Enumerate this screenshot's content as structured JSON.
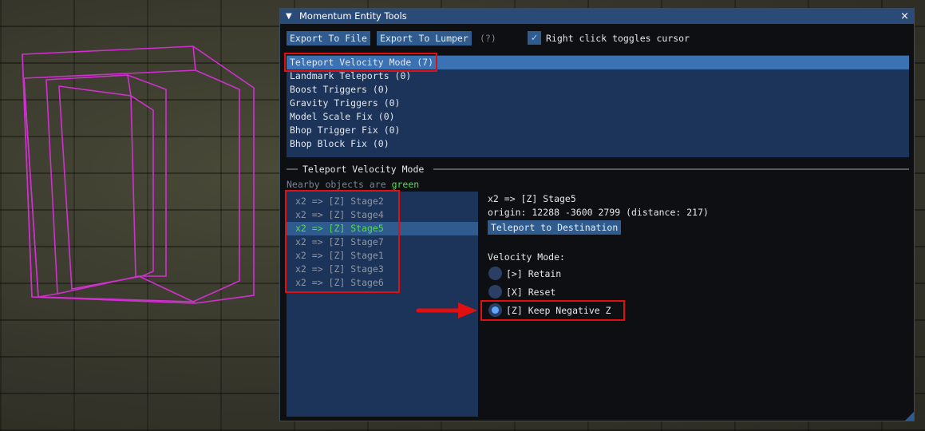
{
  "window": {
    "title": "Momentum Entity Tools",
    "close_glyph": "×",
    "collapse_glyph": "▼"
  },
  "toolbar": {
    "export_file": "Export To File",
    "export_lumper": "Export To Lumper",
    "help": "(?)",
    "cursor_toggle_label": "Right click toggles cursor",
    "cursor_toggle_checked": true
  },
  "categories": [
    {
      "label": "Teleport Velocity Mode (7)",
      "selected": true
    },
    {
      "label": "Landmark Teleports (0)",
      "selected": false
    },
    {
      "label": "Boost Triggers (0)",
      "selected": false
    },
    {
      "label": "Gravity Triggers (0)",
      "selected": false
    },
    {
      "label": "Model Scale Fix (0)",
      "selected": false
    },
    {
      "label": "Bhop Trigger Fix (0)",
      "selected": false
    },
    {
      "label": "Bhop Block Fix (0)",
      "selected": false
    }
  ],
  "section": {
    "title": "Teleport Velocity Mode",
    "nearby_prefix": "Nearby objects are ",
    "nearby_color_word": "green"
  },
  "objects": [
    {
      "label": "x2  => [Z] Stage2",
      "selected": false
    },
    {
      "label": "x2  => [Z] Stage4",
      "selected": false
    },
    {
      "label": "x2  => [Z] Stage5",
      "selected": true
    },
    {
      "label": "x2  => [Z] Stage7",
      "selected": false
    },
    {
      "label": "x2  => [Z] Stage1",
      "selected": false
    },
    {
      "label": "x2  => [Z] Stage3",
      "selected": false
    },
    {
      "label": "x2  => [Z] Stage6",
      "selected": false
    }
  ],
  "detail": {
    "name": "x2  => [Z] Stage5",
    "origin": "origin: 12288 -3600 2799 (distance: 217)",
    "teleport_button": "Teleport to Destination",
    "velocity_label": "Velocity Mode:",
    "modes": [
      {
        "label": "[>] Retain",
        "checked": false
      },
      {
        "label": "[X] Reset",
        "checked": false
      },
      {
        "label": "[Z] Keep Negative Z",
        "checked": true
      }
    ]
  },
  "colors": {
    "accent": "#2f5b8e",
    "highlight": "#e01010",
    "nearby": "#4ee04e",
    "wireframe": "#d030d0"
  },
  "icons": {
    "checkmark": "✓"
  }
}
